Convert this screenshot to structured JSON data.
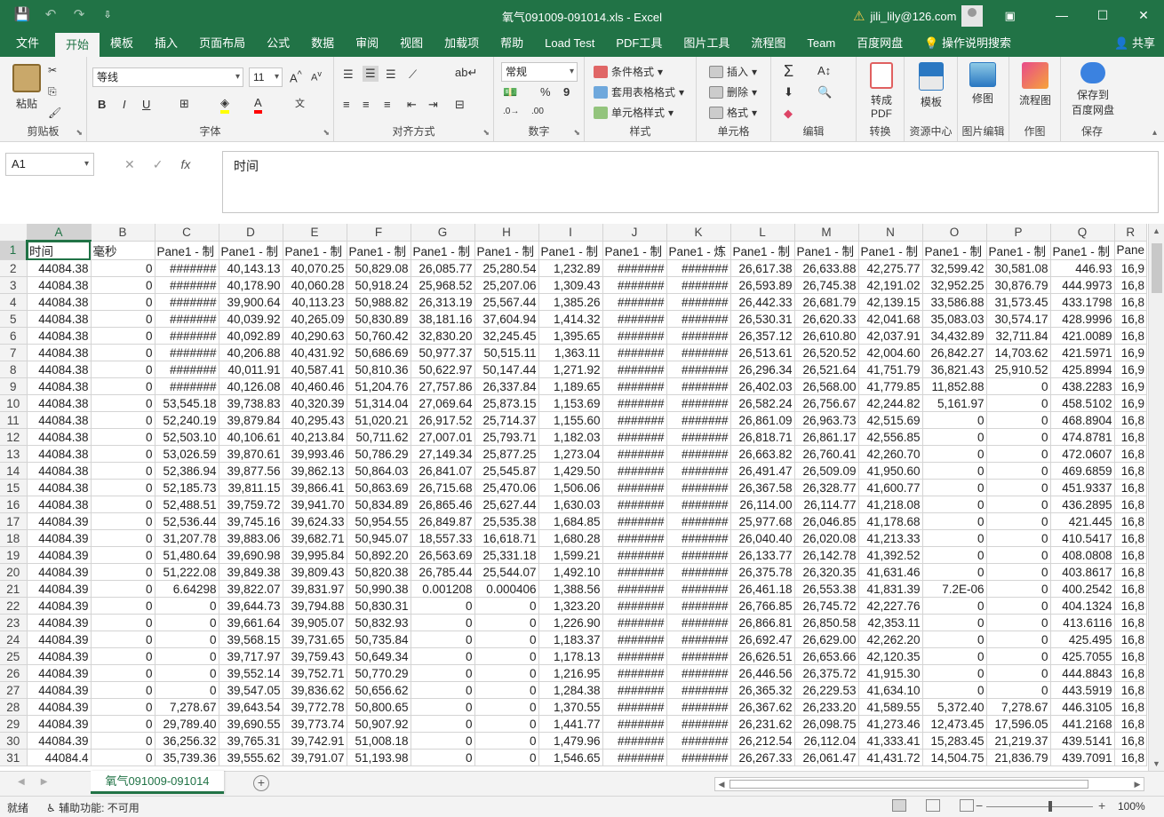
{
  "window": {
    "title": "氧气091009-091014.xls  -  Excel",
    "user": "jili_lily@126.com"
  },
  "tabs": [
    "文件",
    "开始",
    "模板",
    "插入",
    "页面布局",
    "公式",
    "数据",
    "审阅",
    "视图",
    "加载项",
    "帮助",
    "Load Test",
    "PDF工具",
    "图片工具",
    "流程图",
    "Team",
    "百度网盘"
  ],
  "active_tab": "开始",
  "tell_me": "操作说明搜索",
  "share": "共享",
  "ribbon": {
    "clipboard": {
      "paste": "粘贴",
      "label": "剪贴板"
    },
    "font": {
      "name": "等线",
      "size": "11",
      "bold": "B",
      "italic": "I",
      "underline": "U",
      "label": "字体"
    },
    "align": {
      "label": "对齐方式"
    },
    "number": {
      "format": "常规",
      "percent": "%",
      "comma": "9",
      "label": "数字"
    },
    "styles": {
      "cond": "条件格式",
      "table": "套用表格格式",
      "cell": "单元格样式",
      "label": "样式"
    },
    "cells": {
      "insert": "插入",
      "delete": "删除",
      "format": "格式",
      "label": "单元格"
    },
    "edit": {
      "label": "编辑"
    },
    "convert": {
      "btn": "转成\nPDF",
      "btn1": "转成",
      "btn2": "PDF",
      "label": "转换"
    },
    "resource": {
      "btn": "模板",
      "label": "资源中心"
    },
    "imgedit": {
      "btn": "修图",
      "label": "图片编辑"
    },
    "drawing": {
      "btn": "流程图",
      "label": "作图"
    },
    "save": {
      "btn1": "保存到",
      "btn2": "百度网盘",
      "label": "保存"
    }
  },
  "formula_bar": {
    "name_box": "A1",
    "content": "时间"
  },
  "columns": [
    "A",
    "B",
    "C",
    "D",
    "E",
    "F",
    "G",
    "H",
    "I",
    "J",
    "K",
    "L",
    "M",
    "N",
    "O",
    "P",
    "Q",
    "R"
  ],
  "header_row": [
    "时间",
    "毫秒",
    "Pane1 - 制",
    "Pane1 - 制",
    "Pane1 - 制",
    "Pane1 - 制",
    "Pane1 - 制",
    "Pane1 - 制",
    "Pane1 - 制",
    "Pane1 - 制",
    "Pane1 - 炼",
    "Pane1 - 制",
    "Pane1 - 制",
    "Pane1 - 制",
    "Pane1 - 制",
    "Pane1 - 制",
    "Pane1 - 制",
    "Pane"
  ],
  "rows": [
    [
      "44084.38",
      "0",
      "#######",
      "40,143.13",
      "40,070.25",
      "50,829.08",
      "26,085.77",
      "25,280.54",
      "1,232.89",
      "#######",
      "#######",
      "26,617.38",
      "26,633.88",
      "42,275.77",
      "32,599.42",
      "30,581.08",
      "446.93",
      "16,9"
    ],
    [
      "44084.38",
      "0",
      "#######",
      "40,178.90",
      "40,060.28",
      "50,918.24",
      "25,968.52",
      "25,207.06",
      "1,309.43",
      "#######",
      "#######",
      "26,593.89",
      "26,745.38",
      "42,191.02",
      "32,952.25",
      "30,876.79",
      "444.9973",
      "16,8"
    ],
    [
      "44084.38",
      "0",
      "#######",
      "39,900.64",
      "40,113.23",
      "50,988.82",
      "26,313.19",
      "25,567.44",
      "1,385.26",
      "#######",
      "#######",
      "26,442.33",
      "26,681.79",
      "42,139.15",
      "33,586.88",
      "31,573.45",
      "433.1798",
      "16,8"
    ],
    [
      "44084.38",
      "0",
      "#######",
      "40,039.92",
      "40,265.09",
      "50,830.89",
      "38,181.16",
      "37,604.94",
      "1,414.32",
      "#######",
      "#######",
      "26,530.31",
      "26,620.33",
      "42,041.68",
      "35,083.03",
      "30,574.17",
      "428.9996",
      "16,8"
    ],
    [
      "44084.38",
      "0",
      "#######",
      "40,092.89",
      "40,290.63",
      "50,760.42",
      "32,830.20",
      "32,245.45",
      "1,395.65",
      "#######",
      "#######",
      "26,357.12",
      "26,610.80",
      "42,037.91",
      "34,432.89",
      "32,711.84",
      "421.0089",
      "16,8"
    ],
    [
      "44084.38",
      "0",
      "#######",
      "40,206.88",
      "40,431.92",
      "50,686.69",
      "50,977.37",
      "50,515.11",
      "1,363.11",
      "#######",
      "#######",
      "26,513.61",
      "26,520.52",
      "42,004.60",
      "26,842.27",
      "14,703.62",
      "421.5971",
      "16,9"
    ],
    [
      "44084.38",
      "0",
      "#######",
      "40,011.91",
      "40,587.41",
      "50,810.36",
      "50,622.97",
      "50,147.44",
      "1,271.92",
      "#######",
      "#######",
      "26,296.34",
      "26,521.64",
      "41,751.79",
      "36,821.43",
      "25,910.52",
      "425.8994",
      "16,9"
    ],
    [
      "44084.38",
      "0",
      "#######",
      "40,126.08",
      "40,460.46",
      "51,204.76",
      "27,757.86",
      "26,337.84",
      "1,189.65",
      "#######",
      "#######",
      "26,402.03",
      "26,568.00",
      "41,779.85",
      "11,852.88",
      "0",
      "438.2283",
      "16,9"
    ],
    [
      "44084.38",
      "0",
      "53,545.18",
      "39,738.83",
      "40,320.39",
      "51,314.04",
      "27,069.64",
      "25,873.15",
      "1,153.69",
      "#######",
      "#######",
      "26,582.24",
      "26,756.67",
      "42,244.82",
      "5,161.97",
      "0",
      "458.5102",
      "16,9"
    ],
    [
      "44084.38",
      "0",
      "52,240.19",
      "39,879.84",
      "40,295.43",
      "51,020.21",
      "26,917.52",
      "25,714.37",
      "1,155.60",
      "#######",
      "#######",
      "26,861.09",
      "26,963.73",
      "42,515.69",
      "0",
      "0",
      "468.8904",
      "16,8"
    ],
    [
      "44084.38",
      "0",
      "52,503.10",
      "40,106.61",
      "40,213.84",
      "50,711.62",
      "27,007.01",
      "25,793.71",
      "1,182.03",
      "#######",
      "#######",
      "26,818.71",
      "26,861.17",
      "42,556.85",
      "0",
      "0",
      "474.8781",
      "16,8"
    ],
    [
      "44084.38",
      "0",
      "53,026.59",
      "39,870.61",
      "39,993.46",
      "50,786.29",
      "27,149.34",
      "25,877.25",
      "1,273.04",
      "#######",
      "#######",
      "26,663.82",
      "26,760.41",
      "42,260.70",
      "0",
      "0",
      "472.0607",
      "16,8"
    ],
    [
      "44084.38",
      "0",
      "52,386.94",
      "39,877.56",
      "39,862.13",
      "50,864.03",
      "26,841.07",
      "25,545.87",
      "1,429.50",
      "#######",
      "#######",
      "26,491.47",
      "26,509.09",
      "41,950.60",
      "0",
      "0",
      "469.6859",
      "16,8"
    ],
    [
      "44084.38",
      "0",
      "52,185.73",
      "39,811.15",
      "39,866.41",
      "50,863.69",
      "26,715.68",
      "25,470.06",
      "1,506.06",
      "#######",
      "#######",
      "26,367.58",
      "26,328.77",
      "41,600.77",
      "0",
      "0",
      "451.9337",
      "16,8"
    ],
    [
      "44084.38",
      "0",
      "52,488.51",
      "39,759.72",
      "39,941.70",
      "50,834.89",
      "26,865.46",
      "25,627.44",
      "1,630.03",
      "#######",
      "#######",
      "26,114.00",
      "26,114.77",
      "41,218.08",
      "0",
      "0",
      "436.2895",
      "16,8"
    ],
    [
      "44084.39",
      "0",
      "52,536.44",
      "39,745.16",
      "39,624.33",
      "50,954.55",
      "26,849.87",
      "25,535.38",
      "1,684.85",
      "#######",
      "#######",
      "25,977.68",
      "26,046.85",
      "41,178.68",
      "0",
      "0",
      "421.445",
      "16,8"
    ],
    [
      "44084.39",
      "0",
      "31,207.78",
      "39,883.06",
      "39,682.71",
      "50,945.07",
      "18,557.33",
      "16,618.71",
      "1,680.28",
      "#######",
      "#######",
      "26,040.40",
      "26,020.08",
      "41,213.33",
      "0",
      "0",
      "410.5417",
      "16,8"
    ],
    [
      "44084.39",
      "0",
      "51,480.64",
      "39,690.98",
      "39,995.84",
      "50,892.20",
      "26,563.69",
      "25,331.18",
      "1,599.21",
      "#######",
      "#######",
      "26,133.77",
      "26,142.78",
      "41,392.52",
      "0",
      "0",
      "408.0808",
      "16,8"
    ],
    [
      "44084.39",
      "0",
      "51,222.08",
      "39,849.38",
      "39,809.43",
      "50,820.38",
      "26,785.44",
      "25,544.07",
      "1,492.10",
      "#######",
      "#######",
      "26,375.78",
      "26,320.35",
      "41,631.46",
      "0",
      "0",
      "403.8617",
      "16,8"
    ],
    [
      "44084.39",
      "0",
      "6.64298",
      "39,822.07",
      "39,831.97",
      "50,990.38",
      "0.001208",
      "0.000406",
      "1,388.56",
      "#######",
      "#######",
      "26,461.18",
      "26,553.38",
      "41,831.39",
      "7.2E-06",
      "0",
      "400.2542",
      "16,8"
    ],
    [
      "44084.39",
      "0",
      "0",
      "39,644.73",
      "39,794.88",
      "50,830.31",
      "0",
      "0",
      "1,323.20",
      "#######",
      "#######",
      "26,766.85",
      "26,745.72",
      "42,227.76",
      "0",
      "0",
      "404.1324",
      "16,8"
    ],
    [
      "44084.39",
      "0",
      "0",
      "39,661.64",
      "39,905.07",
      "50,832.93",
      "0",
      "0",
      "1,226.90",
      "#######",
      "#######",
      "26,866.81",
      "26,850.58",
      "42,353.11",
      "0",
      "0",
      "413.6116",
      "16,8"
    ],
    [
      "44084.39",
      "0",
      "0",
      "39,568.15",
      "39,731.65",
      "50,735.84",
      "0",
      "0",
      "1,183.37",
      "#######",
      "#######",
      "26,692.47",
      "26,629.00",
      "42,262.20",
      "0",
      "0",
      "425.495",
      "16,8"
    ],
    [
      "44084.39",
      "0",
      "0",
      "39,717.97",
      "39,759.43",
      "50,649.34",
      "0",
      "0",
      "1,178.13",
      "#######",
      "#######",
      "26,626.51",
      "26,653.66",
      "42,120.35",
      "0",
      "0",
      "425.7055",
      "16,8"
    ],
    [
      "44084.39",
      "0",
      "0",
      "39,552.14",
      "39,752.71",
      "50,770.29",
      "0",
      "0",
      "1,216.95",
      "#######",
      "#######",
      "26,446.56",
      "26,375.72",
      "41,915.30",
      "0",
      "0",
      "444.8843",
      "16,8"
    ],
    [
      "44084.39",
      "0",
      "0",
      "39,547.05",
      "39,836.62",
      "50,656.62",
      "0",
      "0",
      "1,284.38",
      "#######",
      "#######",
      "26,365.32",
      "26,229.53",
      "41,634.10",
      "0",
      "0",
      "443.5919",
      "16,8"
    ],
    [
      "44084.39",
      "0",
      "7,278.67",
      "39,643.54",
      "39,772.78",
      "50,800.65",
      "0",
      "0",
      "1,370.55",
      "#######",
      "#######",
      "26,367.62",
      "26,233.20",
      "41,589.55",
      "5,372.40",
      "7,278.67",
      "446.3105",
      "16,8"
    ],
    [
      "44084.39",
      "0",
      "29,789.40",
      "39,690.55",
      "39,773.74",
      "50,907.92",
      "0",
      "0",
      "1,441.77",
      "#######",
      "#######",
      "26,231.62",
      "26,098.75",
      "41,273.46",
      "12,473.45",
      "17,596.05",
      "441.2168",
      "16,8"
    ],
    [
      "44084.39",
      "0",
      "36,256.32",
      "39,765.31",
      "39,742.91",
      "51,008.18",
      "0",
      "0",
      "1,479.96",
      "#######",
      "#######",
      "26,212.54",
      "26,112.04",
      "41,333.41",
      "15,283.45",
      "21,219.37",
      "439.5141",
      "16,8"
    ],
    [
      "44084.4",
      "0",
      "35,739.36",
      "39,555.62",
      "39,791.07",
      "51,193.98",
      "0",
      "0",
      "1,546.65",
      "#######",
      "#######",
      "26,267.33",
      "26,061.47",
      "41,431.72",
      "14,504.75",
      "21,836.79",
      "439.7091",
      "16,8"
    ]
  ],
  "sheet_tab": "氧气091009-091014",
  "status": {
    "ready": "就绪",
    "accessibility": "辅助功能: 不可用",
    "zoom": "100%"
  }
}
